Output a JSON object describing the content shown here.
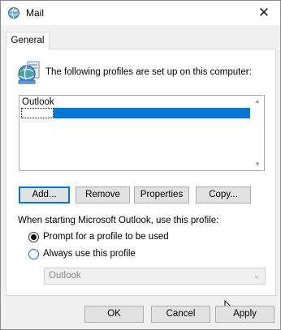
{
  "window": {
    "title": "Mail",
    "close_glyph": "✕",
    "icon": "mail-globe-icon"
  },
  "tabs": [
    {
      "label": "General"
    }
  ],
  "profiles": {
    "intro": "The following profiles are set up on this computer:",
    "list": [
      "Outlook"
    ],
    "selected_index": 1,
    "scroll_up": "▲",
    "scroll_down": "▼"
  },
  "actions": {
    "add": "Add...",
    "remove": "Remove",
    "properties": "Properties",
    "copy": "Copy..."
  },
  "startup": {
    "label": "When starting Microsoft Outlook, use this profile:",
    "options": [
      "Prompt for a profile to be used",
      "Always use this profile"
    ],
    "selected": 0,
    "profile_select": {
      "value": "Outlook",
      "disabled": true,
      "chevron": "⌄"
    }
  },
  "footer": {
    "ok": "OK",
    "cancel": "Cancel",
    "apply": "Apply"
  },
  "colors": {
    "selection": "#0078d7",
    "window_bg": "#f0f0f0",
    "panel_bg": "#ffffff",
    "button_bg": "#e1e1e1"
  }
}
